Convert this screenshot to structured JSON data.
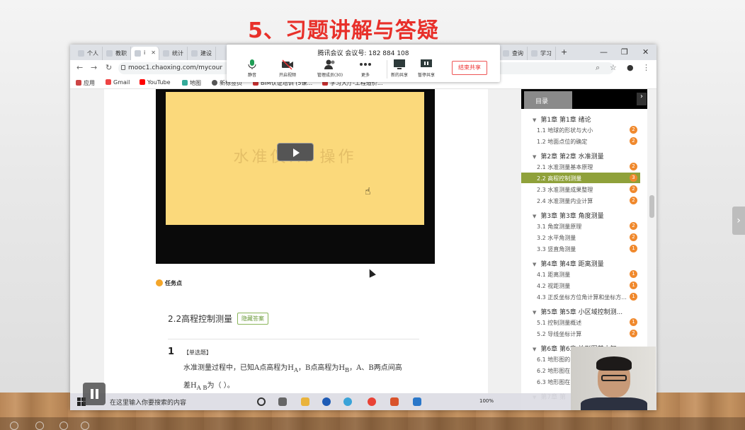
{
  "slide": {
    "title": "5、习题讲解与答疑"
  },
  "browser": {
    "tabs": [
      {
        "label": "个人"
      },
      {
        "label": "教职"
      },
      {
        "label": "i"
      },
      {
        "label": "统计"
      },
      {
        "label": "建设"
      },
      {
        "label": "查询"
      },
      {
        "label": "学习"
      }
    ],
    "new_tab": "+",
    "controls": {
      "minimize": "—",
      "maximize": "❐",
      "close": "✕"
    },
    "url": "mooc1.chaoxing.com/mycour",
    "bookmarks": [
      "应用",
      "Gmail",
      "YouTube",
      "地图",
      "新标签页",
      "BIM认证培训 (5课...",
      "学习大厅-工程造价..."
    ]
  },
  "meeting": {
    "title": "腾讯会议 会议号: 182 884 108",
    "buttons": [
      {
        "label": "静音",
        "icon": "microphone-icon"
      },
      {
        "label": "开启视频",
        "icon": "camera-off-icon"
      },
      {
        "label": "管理成员(30)",
        "icon": "members-icon"
      },
      {
        "label": "更多",
        "icon": "more-icon"
      },
      {
        "label": "新的共享",
        "icon": "new-share-icon"
      },
      {
        "label": "暂停共享",
        "icon": "pause-share-icon"
      }
    ],
    "stop_share": "结束共享"
  },
  "content": {
    "video_watermark": "水准仪... 操作",
    "task_point": "任务点",
    "section_title": "2.2高程控制测量",
    "hide_answer": "隐藏答案",
    "question": {
      "number": "1",
      "type": "【单选题】",
      "text": "水准测量过程中，已知A点高程为H",
      "text_sub_a": "A",
      "text_mid": "，B点高程为H",
      "text_sub_b": "B",
      "text_end": "，A、B两点间高",
      "line2": "差H",
      "line2_sub": "A B",
      "line2_end": "为（    ）。"
    }
  },
  "sidebar": {
    "tab": "目录",
    "arrow": "›",
    "chapters": [
      {
        "title": "第1章 第1章 绪论",
        "sections": [
          {
            "label": "1.1 地球的形状与大小",
            "badge": "2"
          },
          {
            "label": "1.2 地面点位的确定",
            "badge": "2"
          }
        ]
      },
      {
        "title": "第2章 第2章 水准测量",
        "sections": [
          {
            "label": "2.1 水准测量基本原理",
            "badge": "2"
          },
          {
            "label": "2.2 高程控制测量",
            "badge": "3",
            "active": true
          },
          {
            "label": "2.3 水准测量成果整理",
            "badge": "2"
          },
          {
            "label": "2.4 水准测量内业计算",
            "badge": "2"
          }
        ]
      },
      {
        "title": "第3章 第3章 角度测量",
        "sections": [
          {
            "label": "3.1 角度测量原理",
            "badge": "2"
          },
          {
            "label": "3.2 水平角测量",
            "badge": "2"
          },
          {
            "label": "3.3 竖直角测量",
            "badge": "1"
          }
        ]
      },
      {
        "title": "第4章 第4章 距离测量",
        "sections": [
          {
            "label": "4.1 距离测量",
            "badge": "1"
          },
          {
            "label": "4.2 视距测量",
            "badge": "1"
          },
          {
            "label": "4.3 正反坐标方位角计算和坐标方...",
            "badge": "1"
          }
        ]
      },
      {
        "title": "第5章 第5章 小区域控制测...",
        "sections": [
          {
            "label": "5.1 控制测量概述",
            "badge": "1"
          },
          {
            "label": "5.2 导线坐标计算",
            "badge": "2"
          }
        ]
      },
      {
        "title": "第6章 第6章 地形图基本知",
        "sections": [
          {
            "label": "6.1 地形图的",
            "badge": ""
          },
          {
            "label": "6.2 地形图在",
            "badge": ""
          },
          {
            "label": "6.3 地形图在",
            "badge": ""
          }
        ]
      },
      {
        "title": "第7章 第",
        "sections": []
      }
    ]
  },
  "taskbar": {
    "search_placeholder": "在这里输入你要搜索的内容",
    "battery": "100%"
  }
}
